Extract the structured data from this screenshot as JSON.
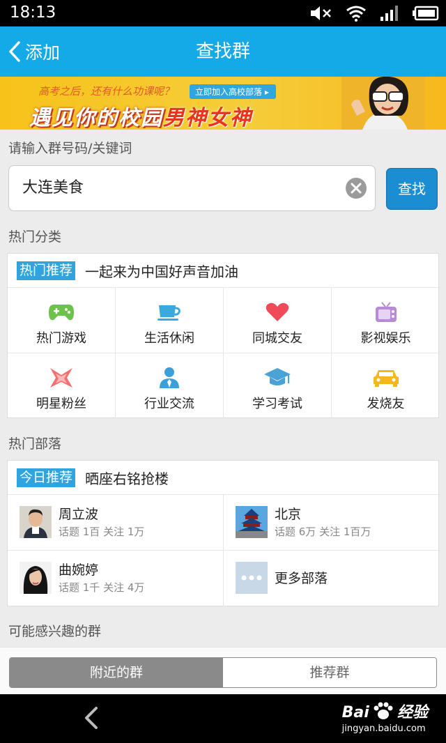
{
  "status_bar": {
    "time": "18:13"
  },
  "header": {
    "back_label": "添加",
    "title": "查找群"
  },
  "banner": {
    "line1": "高考之后，还有什么功课呢？",
    "cta": "立即加入高校部落 ▸",
    "line2_a": "遇见你的校园",
    "line2_b": "男神女神"
  },
  "search": {
    "label": "请输入群号码/关键词",
    "value": "大连美食",
    "button": "查找"
  },
  "hot_categories": {
    "section_label": "热门分类",
    "tag": "热门推荐",
    "headline": "一起来为中国好声音加油",
    "items": [
      {
        "label": "热门游戏",
        "icon": "gamepad-icon",
        "color": "#6cc24a"
      },
      {
        "label": "生活休闲",
        "icon": "coffee-cup-icon",
        "color": "#39a9e0"
      },
      {
        "label": "同城交友",
        "icon": "heart-icon",
        "color": "#ef4a5a"
      },
      {
        "label": "影视娱乐",
        "icon": "tv-icon",
        "color": "#b98ad6"
      },
      {
        "label": "明星粉丝",
        "icon": "star-icon",
        "color": "#ef5a5a"
      },
      {
        "label": "行业交流",
        "icon": "person-tie-icon",
        "color": "#3b9fd9"
      },
      {
        "label": "学习考试",
        "icon": "graduation-cap-icon",
        "color": "#4aa3d6"
      },
      {
        "label": "发烧友",
        "icon": "car-icon",
        "color": "#f4b81c"
      }
    ]
  },
  "hot_tribes": {
    "section_label": "热门部落",
    "tag": "今日推荐",
    "headline": "晒座右铭抢楼",
    "items": [
      {
        "name": "周立波",
        "stats": "话题 1百  关注 1万"
      },
      {
        "name": "北京",
        "stats": "话题 6万  关注 1百万"
      },
      {
        "name": "曲婉婷",
        "stats": "话题 1千  关注 4万"
      },
      {
        "name": "更多部落",
        "stats": ""
      }
    ]
  },
  "interest": {
    "section_label": "可能感兴趣的群",
    "tabs": [
      "附近的群",
      "推荐群"
    ]
  },
  "watermark": {
    "brand": "Bai",
    "brand2": "经验",
    "url": "jingyan.baidu.com"
  }
}
